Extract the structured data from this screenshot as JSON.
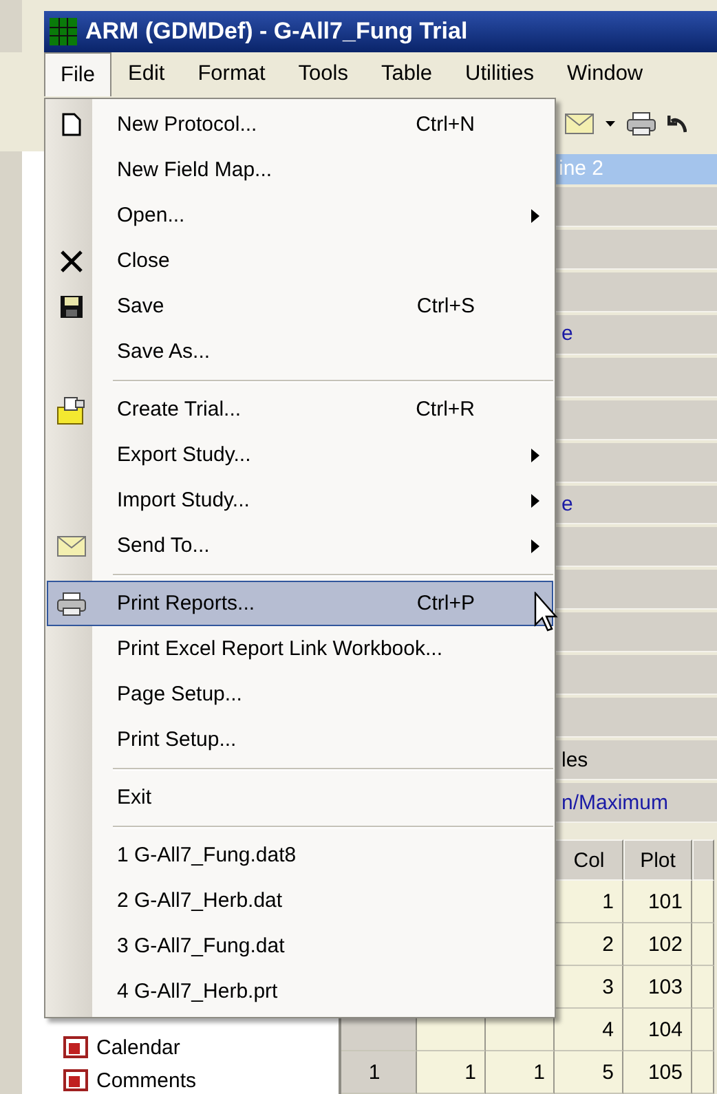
{
  "window": {
    "title": "ARM (GDMDef) - G-All7_Fung Trial"
  },
  "menu_bar": [
    {
      "label": "File",
      "selected": true
    },
    {
      "label": "Edit",
      "selected": false
    },
    {
      "label": "Format",
      "selected": false
    },
    {
      "label": "Tools",
      "selected": false
    },
    {
      "label": "Table",
      "selected": false
    },
    {
      "label": "Utilities",
      "selected": false
    },
    {
      "label": "Window",
      "selected": false
    }
  ],
  "file_menu": [
    {
      "kind": "item",
      "label": "New Protocol...",
      "shortcut": "Ctrl+N",
      "submenu": false,
      "selected": false
    },
    {
      "kind": "item",
      "label": "New Field Map...",
      "submenu": false,
      "selected": false
    },
    {
      "kind": "item",
      "label": "Open...",
      "submenu": true,
      "selected": false
    },
    {
      "kind": "item",
      "label": "Close",
      "submenu": false,
      "selected": false
    },
    {
      "kind": "item",
      "label": "Save",
      "shortcut": "Ctrl+S",
      "submenu": false,
      "selected": false
    },
    {
      "kind": "item",
      "label": "Save As...",
      "submenu": false,
      "selected": false
    },
    {
      "kind": "separator"
    },
    {
      "kind": "item",
      "label": "Create Trial...",
      "shortcut": "Ctrl+R",
      "submenu": false,
      "selected": false
    },
    {
      "kind": "item",
      "label": "Export Study...",
      "submenu": true,
      "selected": false
    },
    {
      "kind": "item",
      "label": "Import Study...",
      "submenu": true,
      "selected": false
    },
    {
      "kind": "item",
      "label": "Send To...",
      "submenu": true,
      "selected": false
    },
    {
      "kind": "separator"
    },
    {
      "kind": "item",
      "label": "Print Reports...",
      "shortcut": "Ctrl+P",
      "submenu": false,
      "selected": true
    },
    {
      "kind": "item",
      "label": "Print Excel Report Link Workbook...",
      "submenu": false,
      "selected": false
    },
    {
      "kind": "item",
      "label": "Page Setup...",
      "submenu": false,
      "selected": false
    },
    {
      "kind": "item",
      "label": "Print Setup...",
      "submenu": false,
      "selected": false
    },
    {
      "kind": "separator"
    },
    {
      "kind": "item",
      "label": "Exit",
      "submenu": false,
      "selected": false
    },
    {
      "kind": "separator"
    },
    {
      "kind": "item",
      "label": "1 G-All7_Fung.dat8",
      "submenu": false,
      "selected": false
    },
    {
      "kind": "item",
      "label": "2 G-All7_Herb.dat",
      "submenu": false,
      "selected": false
    },
    {
      "kind": "item",
      "label": "3 G-All7_Fung.dat",
      "submenu": false,
      "selected": false
    },
    {
      "kind": "item",
      "label": "4 G-All7_Herb.prt",
      "submenu": false,
      "selected": false
    }
  ],
  "grid_header": {
    "text": "ine 2"
  },
  "property_rows": [
    {
      "kind": "blank"
    },
    {
      "kind": "blank"
    },
    {
      "kind": "blank"
    },
    {
      "kind": "link",
      "text": "e"
    },
    {
      "kind": "blank"
    },
    {
      "kind": "blank"
    },
    {
      "kind": "blank"
    },
    {
      "kind": "link",
      "text": "e"
    },
    {
      "kind": "blank"
    },
    {
      "kind": "blank"
    },
    {
      "kind": "blank"
    },
    {
      "kind": "blank"
    },
    {
      "kind": "blank"
    },
    {
      "kind": "plain",
      "text": "les"
    },
    {
      "kind": "link",
      "text": "n/Maximum"
    }
  ],
  "table": {
    "columns": [
      "Col",
      "Plot"
    ],
    "rows": [
      {
        "cells": [
          "1",
          "101"
        ]
      },
      {
        "cells": [
          "2",
          "102"
        ]
      },
      {
        "cells": [
          "3",
          "103"
        ]
      },
      {
        "cells": [
          "4",
          "104"
        ]
      },
      {
        "cells": [
          "1",
          "1",
          "1",
          "5",
          "105"
        ]
      }
    ]
  },
  "tree": {
    "items": [
      {
        "label": "Calendar"
      },
      {
        "label": "Comments"
      }
    ]
  }
}
